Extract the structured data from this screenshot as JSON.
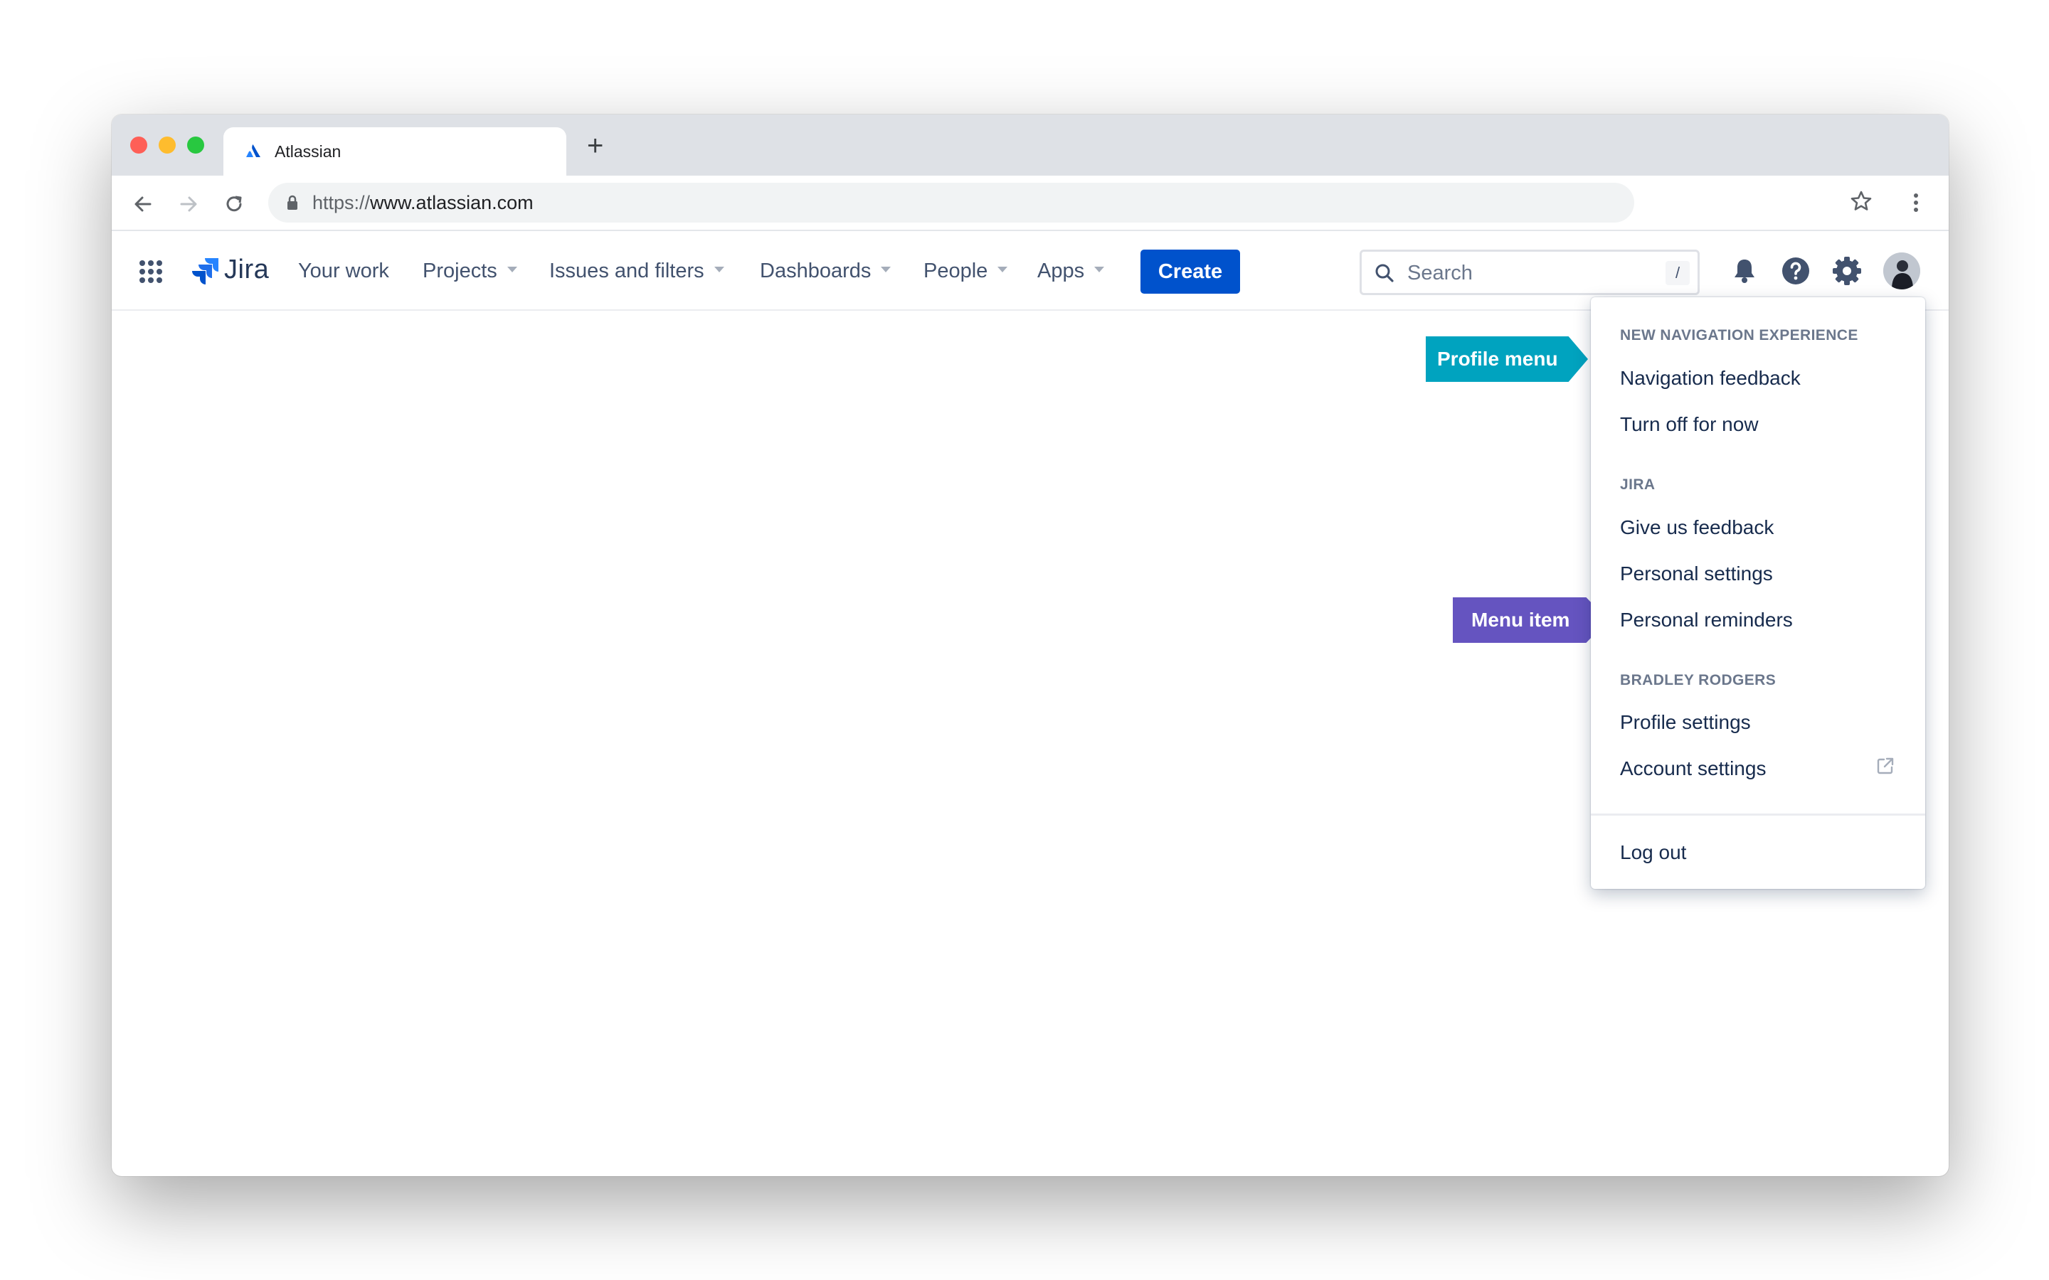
{
  "browser": {
    "tab_title": "Atlassian",
    "new_tab_label": "+",
    "url_scheme": "https://",
    "url_host": "www.atlassian.com"
  },
  "jira": {
    "product_name": "Jira",
    "nav": [
      {
        "label": "Your work",
        "has_dropdown": false
      },
      {
        "label": "Projects",
        "has_dropdown": true
      },
      {
        "label": "Issues and filters",
        "has_dropdown": true
      },
      {
        "label": "Dashboards",
        "has_dropdown": true
      },
      {
        "label": "People",
        "has_dropdown": true
      },
      {
        "label": "Apps",
        "has_dropdown": true
      }
    ],
    "create_label": "Create",
    "search": {
      "placeholder": "Search",
      "shortcut": "/"
    },
    "icons": [
      "app-switcher-icon",
      "bell-icon",
      "help-icon",
      "settings-icon",
      "avatar"
    ]
  },
  "profile_menu": {
    "sections": [
      {
        "heading": "NEW NAVIGATION EXPERIENCE",
        "items": [
          "Navigation feedback",
          "Turn off for now"
        ]
      },
      {
        "heading": "JIRA",
        "items": [
          "Give us feedback",
          "Personal settings",
          "Personal reminders"
        ]
      },
      {
        "heading": "BRADLEY RODGERS",
        "items": [
          "Profile settings",
          "Account settings"
        ]
      }
    ],
    "logout": "Log out"
  },
  "annotations": {
    "profile_menu": "Profile menu",
    "menu_item": "Menu item"
  },
  "colors": {
    "primary": "#0052cc",
    "callout_teal": "#00a3bf",
    "callout_purple": "#6554c0"
  }
}
